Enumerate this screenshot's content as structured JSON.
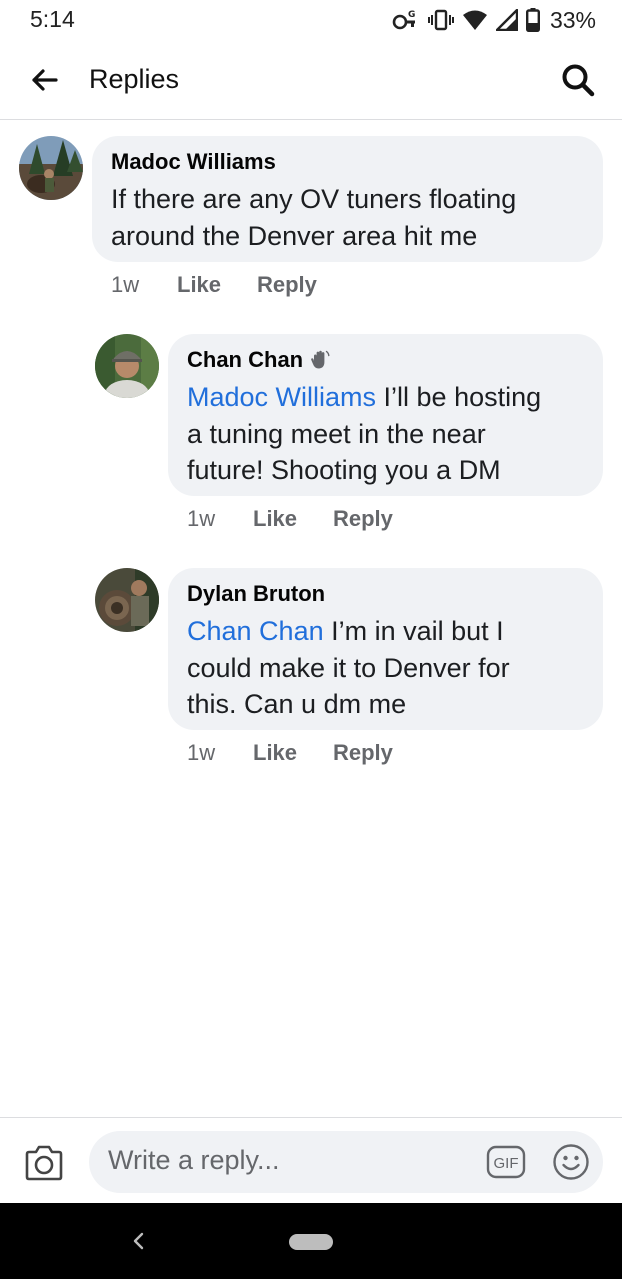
{
  "status_bar": {
    "time": "5:14",
    "battery": "33%",
    "icons": [
      "key-g-icon",
      "vibrate-icon",
      "wifi-icon",
      "signal-icon",
      "battery-icon"
    ]
  },
  "header": {
    "title": "Replies",
    "back_icon": "arrow-left-icon",
    "search_icon": "search-icon"
  },
  "comments": [
    {
      "author": "Madoc Williams",
      "mention": "",
      "lines": [
        "If there are any OV tuners floating",
        "around the Denver area hit me"
      ],
      "time": "1w",
      "like_label": "Like",
      "reply_label": "Reply"
    },
    {
      "author": "Chan Chan",
      "badge_icon": "waving-hand-icon",
      "mention": "Madoc Williams",
      "lines": [
        " I’ll be hosting",
        "a tuning meet in the near",
        "future! Shooting you a DM"
      ],
      "time": "1w",
      "like_label": "Like",
      "reply_label": "Reply"
    },
    {
      "author": "Dylan Bruton",
      "mention": "Chan Chan",
      "lines": [
        " I’m in vail but I",
        "could make it to Denver for",
        "this. Can u dm me"
      ],
      "time": "1w",
      "like_label": "Like",
      "reply_label": "Reply"
    }
  ],
  "composer": {
    "placeholder": "Write a reply...",
    "camera_icon": "camera-icon",
    "gif_label": "GIF",
    "emoji_icon": "smiley-icon"
  },
  "colors": {
    "mention": "#216fdb",
    "bubble": "#f0f2f5",
    "secondary_text": "#65676b"
  }
}
